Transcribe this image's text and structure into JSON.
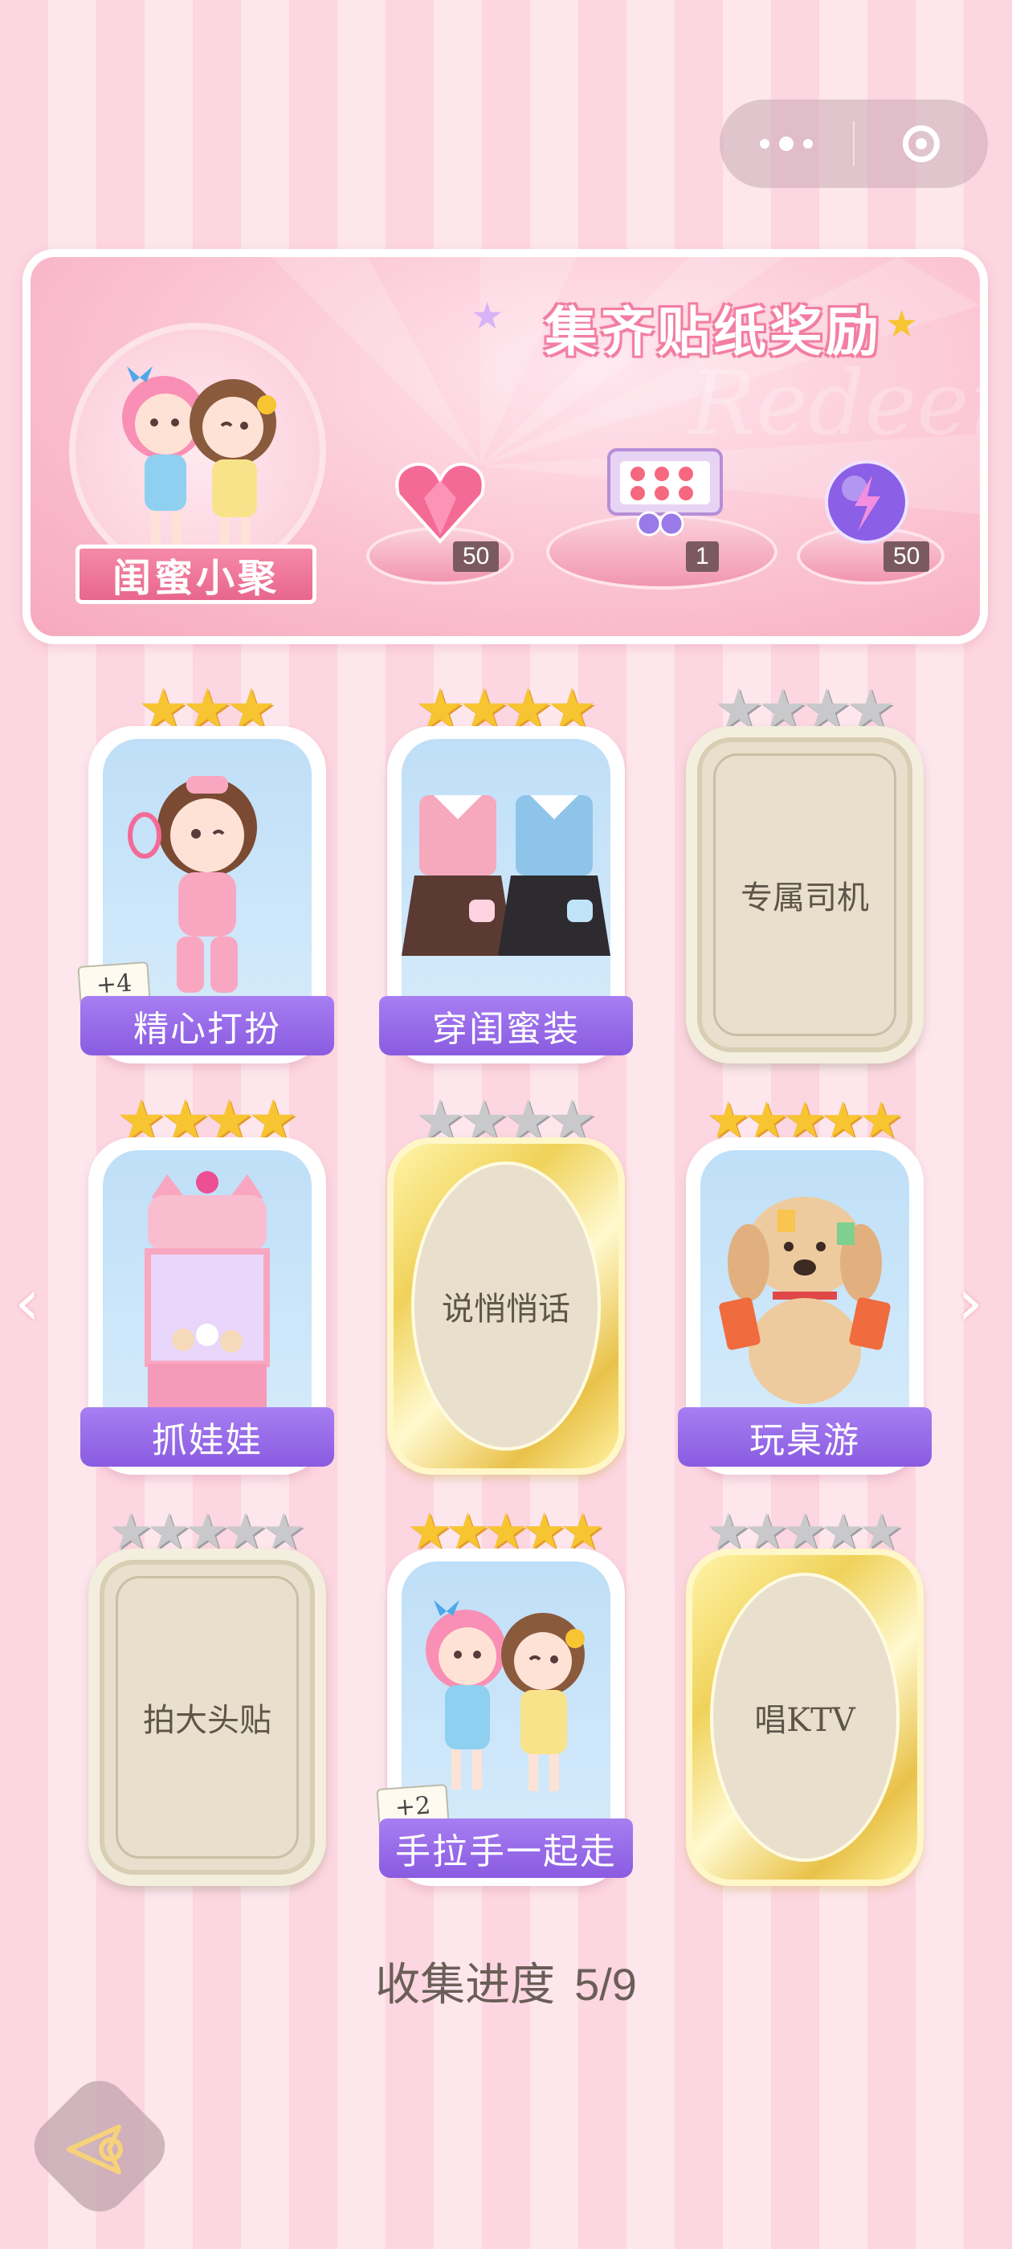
{
  "capsule": {
    "more_icon": "more-dots-icon",
    "close_icon": "target-close-icon"
  },
  "banner": {
    "title": "集齐贴纸奖励",
    "avatar_label": "闺蜜小聚",
    "rewards": [
      {
        "icon": "pink-heart-gem",
        "count": "50"
      },
      {
        "icon": "gift-box",
        "count": "1"
      },
      {
        "icon": "purple-energy-orb",
        "count": "50"
      }
    ]
  },
  "cards": [
    {
      "label": "精心打扮",
      "unlocked": true,
      "stars_total": 3,
      "stars_on": 3,
      "badge": "+4",
      "art": "girl-makeup"
    },
    {
      "label": "穿闺蜜装",
      "unlocked": true,
      "stars_total": 4,
      "stars_on": 4,
      "badge": "",
      "art": "matching-outfits"
    },
    {
      "label": "专属司机",
      "unlocked": false,
      "style": "plain",
      "stars_total": 4,
      "stars_on": 0
    },
    {
      "label": "抓娃娃",
      "unlocked": true,
      "stars_total": 4,
      "stars_on": 4,
      "badge": "",
      "art": "claw-machine"
    },
    {
      "label": "说悄悄话",
      "unlocked": false,
      "style": "gold",
      "stars_total": 4,
      "stars_on": 0
    },
    {
      "label": "玩桌游",
      "unlocked": true,
      "stars_total": 5,
      "stars_on": 5,
      "badge": "",
      "art": "dog-cards"
    },
    {
      "label": "拍大头贴",
      "unlocked": false,
      "style": "plain",
      "stars_total": 5,
      "stars_on": 0
    },
    {
      "label": "手拉手一起走",
      "unlocked": true,
      "stars_total": 5,
      "stars_on": 5,
      "badge": "+2",
      "art": "girls-walking"
    },
    {
      "label": "唱KTV",
      "unlocked": false,
      "style": "gold",
      "stars_total": 5,
      "stars_on": 0
    }
  ],
  "progress": {
    "label": "收集进度",
    "value": "5/9"
  },
  "colors": {
    "accent": "#8a5be0",
    "star_on": "#f7c531",
    "star_off": "#c9c9cc",
    "pink": "#f58aa9"
  }
}
